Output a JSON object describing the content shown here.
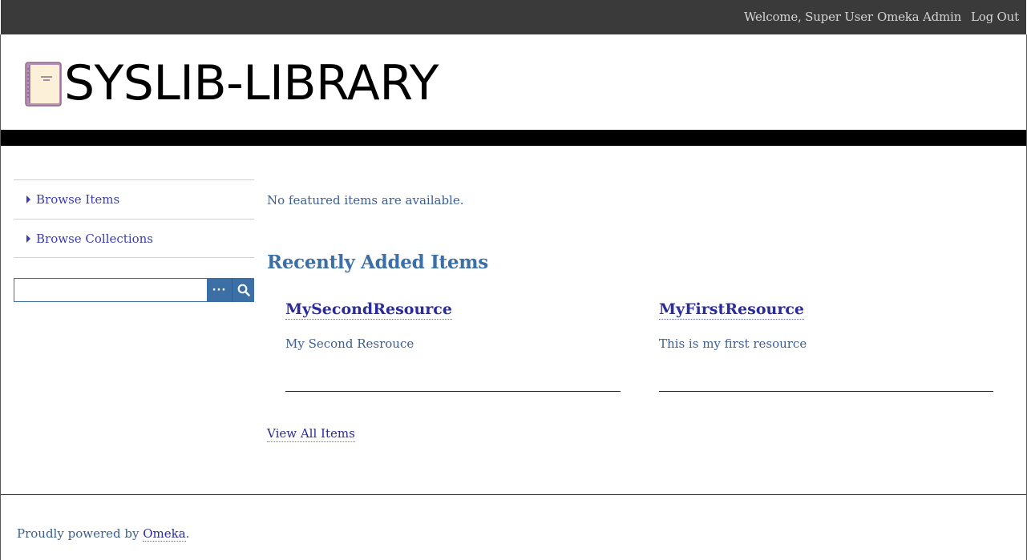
{
  "admin_bar": {
    "welcome": "Welcome, Super User",
    "admin_link": "Omeka Admin",
    "logout": "Log Out"
  },
  "header": {
    "site_title": "SYSLIB-LIBRARY",
    "logo_icon": "book-icon"
  },
  "sidebar": {
    "nav": [
      {
        "label": "Browse Items"
      },
      {
        "label": "Browse Collections"
      }
    ],
    "search": {
      "value": "",
      "advanced_label": "···",
      "submit_icon": "search-icon"
    }
  },
  "main": {
    "featured_note": "No featured items are available.",
    "recent_heading": "Recently Added Items",
    "items": [
      {
        "title": "MySecondResource",
        "description": "My Second Resrouce"
      },
      {
        "title": "MyFirstResource",
        "description": "This is my first resource"
      }
    ],
    "view_all": "View All Items"
  },
  "footer": {
    "prefix": "Proudly powered by ",
    "link": "Omeka",
    "suffix": "."
  },
  "colors": {
    "admin_bar": "#3a3a3a",
    "link": "#3b3db3",
    "heading": "#3b6fa6",
    "search_button": "#3b6fa6"
  }
}
